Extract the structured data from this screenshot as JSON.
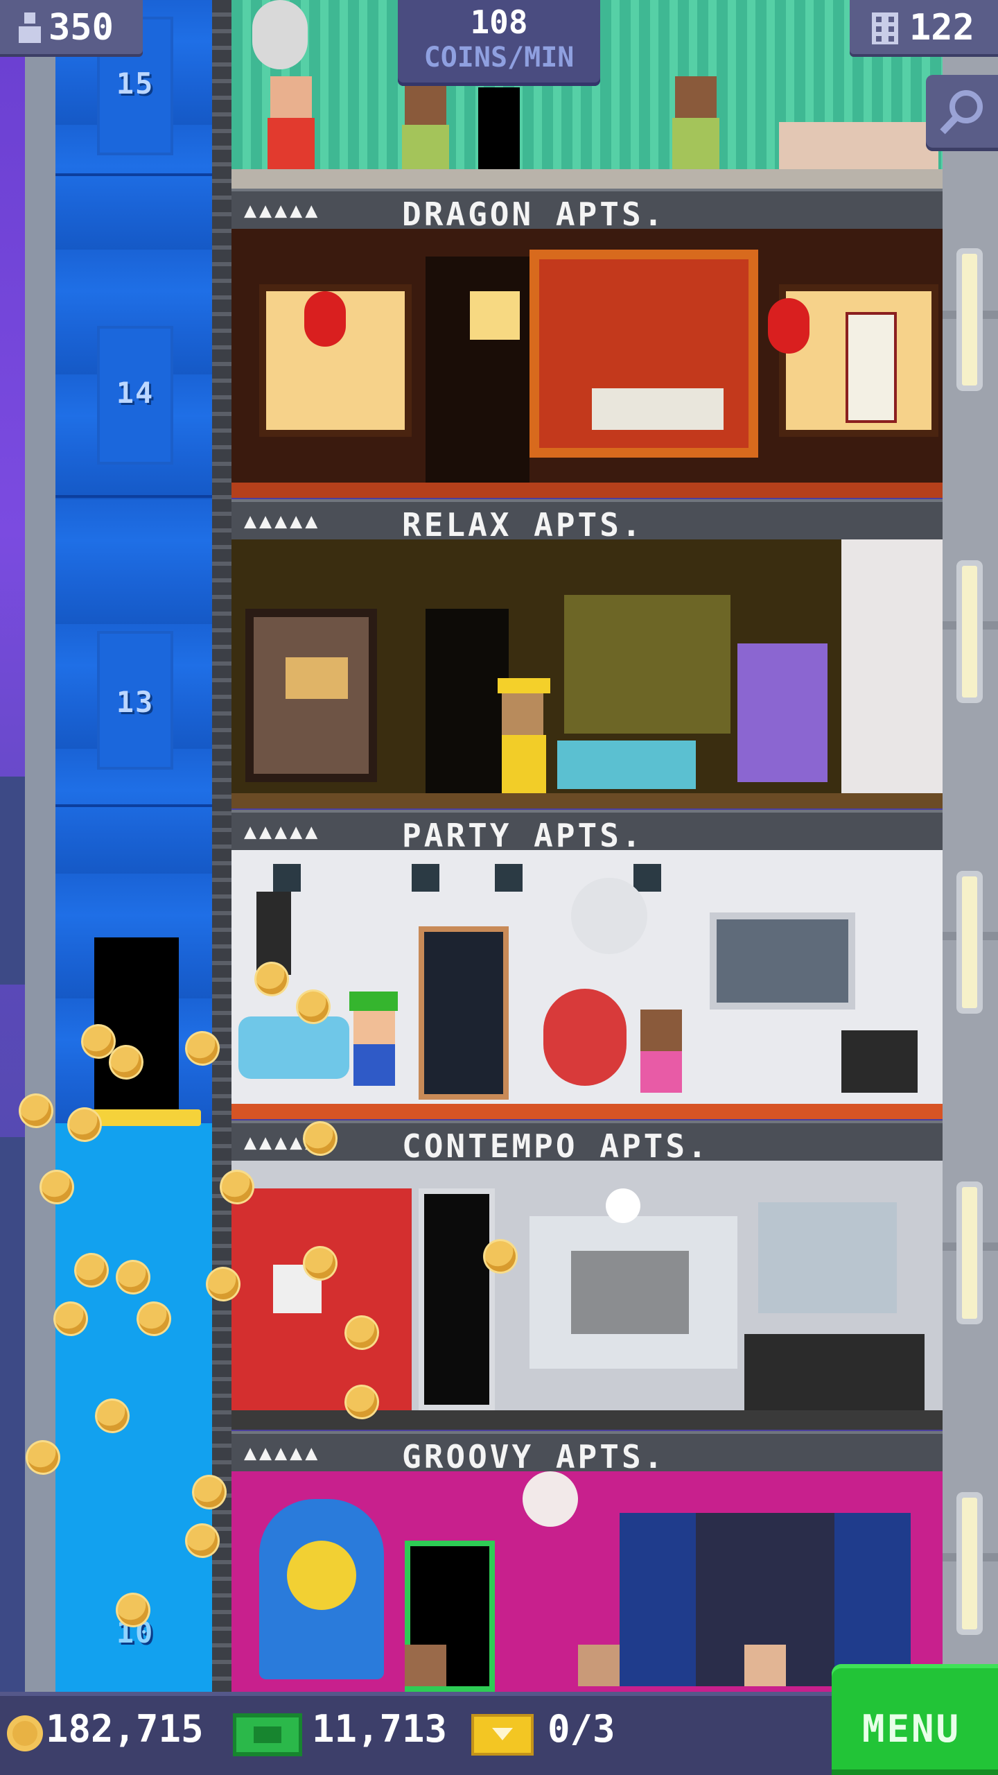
{
  "hud": {
    "population": "350",
    "coins_per_min_value": "108",
    "coins_per_min_label": "COINS/MIN",
    "floor_count": "122"
  },
  "elevator": {
    "floor_numbers": [
      "15",
      "14",
      "13",
      "10"
    ]
  },
  "floors": [
    {
      "name": "DRAGON APTS.",
      "stars": "▲▲▲▲▲"
    },
    {
      "name": "RELAX APTS.",
      "stars": "▲▲▲▲▲"
    },
    {
      "name": "PARTY APTS.",
      "stars": "▲▲▲▲▲"
    },
    {
      "name": "CONTEMPO APTS.",
      "stars": "▲▲▲▲▲"
    },
    {
      "name": "GROOVY APTS.",
      "stars": "▲▲▲▲▲"
    }
  ],
  "bottom_bar": {
    "coins": "182,715",
    "bux": "11,713",
    "tickets": "0/3",
    "menu_label": "MENU"
  },
  "icons": {
    "population": "person-icon",
    "floors": "building-icon",
    "zoom": "magnifier-icon",
    "coin": "coin-icon",
    "bux": "cash-icon",
    "ticket": "ticket-icon"
  },
  "colors": {
    "menu_green": "#22c437",
    "elevator_blue": "#1a63d6",
    "hud_panel": "#5a5d88",
    "coin_gold": "#f2c45a"
  }
}
